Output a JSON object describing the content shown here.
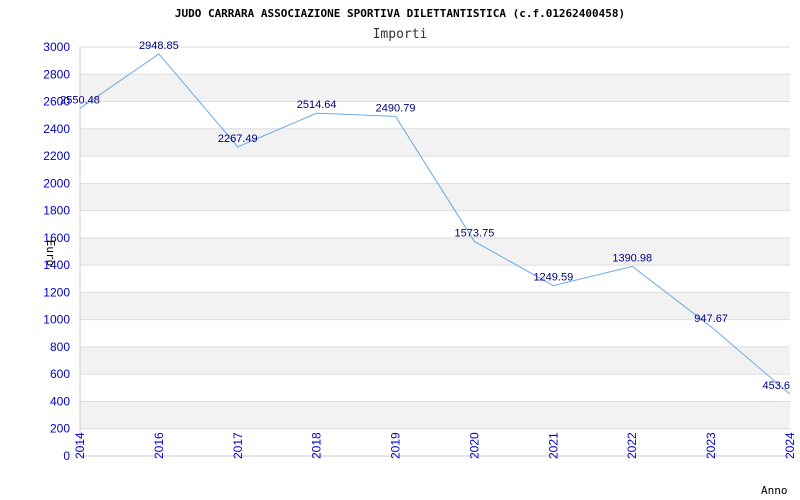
{
  "chart_data": {
    "type": "line",
    "title": "JUDO CARRARA ASSOCIAZIONE SPORTIVA DILETTANTISTICA (c.f.01262400458)",
    "subtitle": "Importi",
    "xlabel": "Anno",
    "ylabel": "Euro",
    "categories": [
      "2014",
      "2016",
      "2017",
      "2018",
      "2019",
      "2020",
      "2021",
      "2022",
      "2023",
      "2024"
    ],
    "values": [
      2550.48,
      2948.85,
      2267.49,
      2514.64,
      2490.79,
      1573.75,
      1249.59,
      1390.98,
      947.67,
      453.6
    ],
    "value_labels": [
      "2550.48",
      "2948.85",
      "2267.49",
      "2514.64",
      "2490.79",
      "1573.75",
      "1249.59",
      "1390.98",
      "947.67",
      "453.6"
    ],
    "ylim": [
      0,
      3000
    ],
    "yticks": [
      0,
      200,
      400,
      600,
      800,
      1000,
      1200,
      1400,
      1600,
      1800,
      2000,
      2200,
      2400,
      2600,
      2800,
      3000
    ],
    "grid": true,
    "colors": {
      "line": "#6aaae8",
      "band": "#f2f2f2",
      "gridline": "#dddddd",
      "tick_text": "#0000cc",
      "label_text": "#000080"
    }
  }
}
